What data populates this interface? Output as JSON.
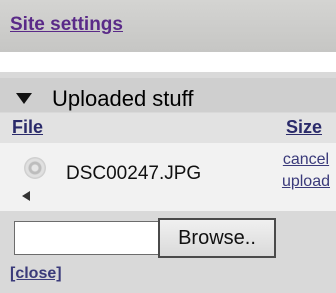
{
  "site": {
    "link_label": "Site settings"
  },
  "panel": {
    "title": "Uploaded stuff",
    "columns": {
      "file": "File",
      "size": "Size"
    },
    "file_row": {
      "name": "DSC00247.JPG",
      "cancel_line1": "cancel",
      "cancel_line2": "upload"
    },
    "file_input": {
      "value": ""
    },
    "browse_label": "Browse..",
    "close_label": "[close]"
  }
}
